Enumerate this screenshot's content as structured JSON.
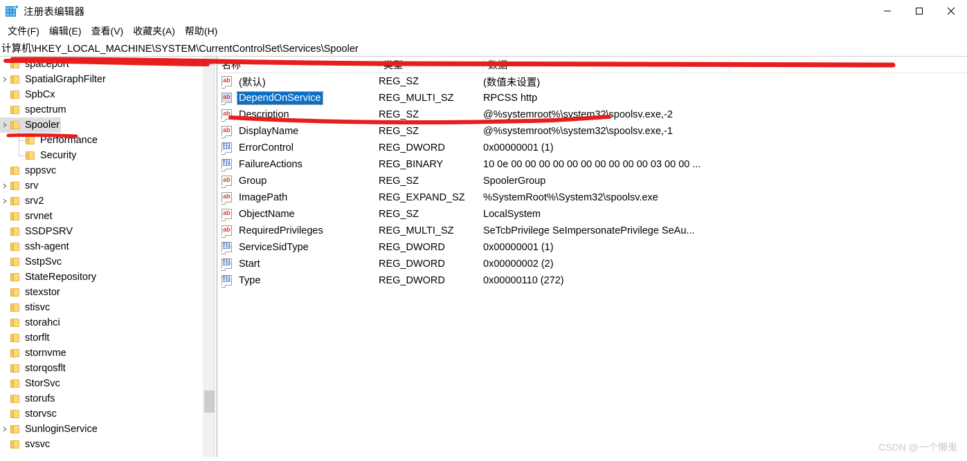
{
  "window": {
    "title": "注册表编辑器",
    "icon": "registry-grid-icon",
    "minimize_label": "—",
    "maximize_label": "□",
    "close_label": "✕"
  },
  "menu": {
    "items": [
      {
        "label": "文件(F)"
      },
      {
        "label": "编辑(E)"
      },
      {
        "label": "查看(V)"
      },
      {
        "label": "收藏夹(A)"
      },
      {
        "label": "帮助(H)"
      }
    ]
  },
  "address": {
    "path": "计算机\\HKEY_LOCAL_MACHINE\\SYSTEM\\CurrentControlSet\\Services\\Spooler"
  },
  "tree": {
    "nodes": [
      {
        "label": "spaceport",
        "depth": 0,
        "selected": false,
        "expandable": false
      },
      {
        "label": "SpatialGraphFilter",
        "depth": 0,
        "selected": false,
        "expandable": true
      },
      {
        "label": "SpbCx",
        "depth": 0,
        "selected": false,
        "expandable": false
      },
      {
        "label": "spectrum",
        "depth": 0,
        "selected": false,
        "expandable": false
      },
      {
        "label": "Spooler",
        "depth": 0,
        "selected": true,
        "expandable": true
      },
      {
        "label": "Performance",
        "depth": 1,
        "selected": false,
        "expandable": false
      },
      {
        "label": "Security",
        "depth": 1,
        "selected": false,
        "expandable": false
      },
      {
        "label": "sppsvc",
        "depth": 0,
        "selected": false,
        "expandable": false
      },
      {
        "label": "srv",
        "depth": 0,
        "selected": false,
        "expandable": true
      },
      {
        "label": "srv2",
        "depth": 0,
        "selected": false,
        "expandable": true
      },
      {
        "label": "srvnet",
        "depth": 0,
        "selected": false,
        "expandable": false
      },
      {
        "label": "SSDPSRV",
        "depth": 0,
        "selected": false,
        "expandable": false
      },
      {
        "label": "ssh-agent",
        "depth": 0,
        "selected": false,
        "expandable": false
      },
      {
        "label": "SstpSvc",
        "depth": 0,
        "selected": false,
        "expandable": false
      },
      {
        "label": "StateRepository",
        "depth": 0,
        "selected": false,
        "expandable": false
      },
      {
        "label": "stexstor",
        "depth": 0,
        "selected": false,
        "expandable": false
      },
      {
        "label": "stisvc",
        "depth": 0,
        "selected": false,
        "expandable": false
      },
      {
        "label": "storahci",
        "depth": 0,
        "selected": false,
        "expandable": false
      },
      {
        "label": "storflt",
        "depth": 0,
        "selected": false,
        "expandable": false
      },
      {
        "label": "stornvme",
        "depth": 0,
        "selected": false,
        "expandable": false
      },
      {
        "label": "storqosflt",
        "depth": 0,
        "selected": false,
        "expandable": false
      },
      {
        "label": "StorSvc",
        "depth": 0,
        "selected": false,
        "expandable": false
      },
      {
        "label": "storufs",
        "depth": 0,
        "selected": false,
        "expandable": false
      },
      {
        "label": "storvsc",
        "depth": 0,
        "selected": false,
        "expandable": false
      },
      {
        "label": "SunloginService",
        "depth": 0,
        "selected": false,
        "expandable": true
      },
      {
        "label": "svsvc",
        "depth": 0,
        "selected": false,
        "expandable": false
      },
      {
        "label": "",
        "depth": 0,
        "selected": false,
        "expandable": false
      }
    ]
  },
  "list": {
    "columns": [
      {
        "label": "名称"
      },
      {
        "label": "类型"
      },
      {
        "label": "数据"
      }
    ],
    "rows": [
      {
        "name": "(默认)",
        "type": "REG_SZ",
        "data": "(数值未设置)",
        "icon": "string-value-icon",
        "selected": false
      },
      {
        "name": "DependOnService",
        "type": "REG_MULTI_SZ",
        "data": "RPCSS http",
        "icon": "string-value-icon",
        "selected": true
      },
      {
        "name": "Description",
        "type": "REG_SZ",
        "data": "@%systemroot%\\system32\\spoolsv.exe,-2",
        "icon": "string-value-icon",
        "selected": false
      },
      {
        "name": "DisplayName",
        "type": "REG_SZ",
        "data": "@%systemroot%\\system32\\spoolsv.exe,-1",
        "icon": "string-value-icon",
        "selected": false
      },
      {
        "name": "ErrorControl",
        "type": "REG_DWORD",
        "data": "0x00000001 (1)",
        "icon": "binary-value-icon",
        "selected": false
      },
      {
        "name": "FailureActions",
        "type": "REG_BINARY",
        "data": "10 0e 00 00 00 00 00 00 00 00 00 00 03 00 00 ...",
        "icon": "binary-value-icon",
        "selected": false
      },
      {
        "name": "Group",
        "type": "REG_SZ",
        "data": "SpoolerGroup",
        "icon": "string-value-icon",
        "selected": false
      },
      {
        "name": "ImagePath",
        "type": "REG_EXPAND_SZ",
        "data": "%SystemRoot%\\System32\\spoolsv.exe",
        "icon": "string-value-icon",
        "selected": false
      },
      {
        "name": "ObjectName",
        "type": "REG_SZ",
        "data": "LocalSystem",
        "icon": "string-value-icon",
        "selected": false
      },
      {
        "name": "RequiredPrivileges",
        "type": "REG_MULTI_SZ",
        "data": "SeTcbPrivilege SeImpersonatePrivilege SeAu...",
        "icon": "string-value-icon",
        "selected": false
      },
      {
        "name": "ServiceSidType",
        "type": "REG_DWORD",
        "data": "0x00000001 (1)",
        "icon": "binary-value-icon",
        "selected": false
      },
      {
        "name": "Start",
        "type": "REG_DWORD",
        "data": "0x00000002 (2)",
        "icon": "binary-value-icon",
        "selected": false
      },
      {
        "name": "Type",
        "type": "REG_DWORD",
        "data": "0x00000110 (272)",
        "icon": "binary-value-icon",
        "selected": false
      }
    ]
  },
  "annotations": {
    "color": "#e81e1e",
    "marks": [
      {
        "name": "address-underline"
      },
      {
        "name": "top-divider-line"
      },
      {
        "name": "spooler-underline"
      },
      {
        "name": "description-strikethrough"
      }
    ]
  },
  "watermark": {
    "text": "CSDN @一个懒鬼"
  }
}
